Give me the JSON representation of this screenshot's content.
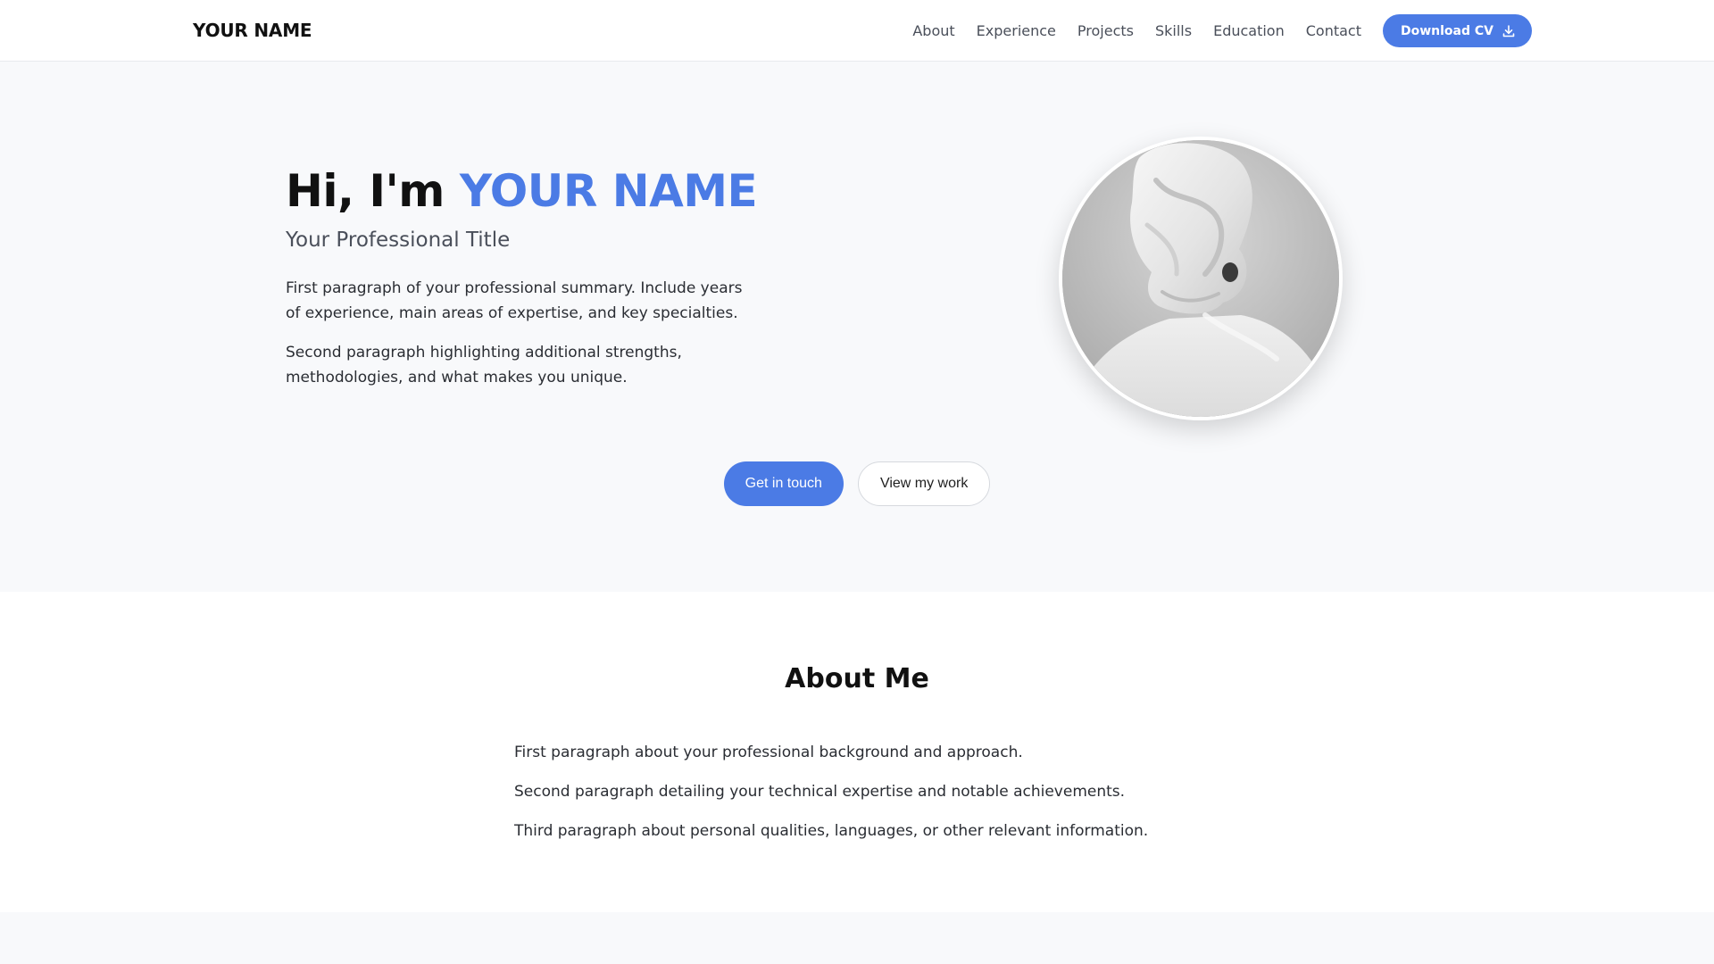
{
  "nav": {
    "brand": "YOUR NAME",
    "links": [
      "About",
      "Experience",
      "Projects",
      "Skills",
      "Education",
      "Contact"
    ],
    "cv_button": "Download CV",
    "cv_icon": "download-icon"
  },
  "hero": {
    "greeting": "Hi, I'm ",
    "name": "YOUR NAME",
    "subtitle": "Your Professional Title",
    "paragraph1": "First paragraph of your professional summary. Include years of experience, main areas of expertise, and key specialties.",
    "paragraph2": "Second paragraph highlighting additional strengths, methodologies, and what makes you unique.",
    "primary_button": "Get in touch",
    "secondary_button": "View my work"
  },
  "about": {
    "title": "About Me",
    "paragraphs": [
      "First paragraph about your professional background and approach.",
      "Second paragraph detailing your technical expertise and notable achievements.",
      "Third paragraph about personal qualities, languages, or other relevant information."
    ]
  },
  "colors": {
    "accent": "#4b7be5",
    "hero_background": "#f8f9fb",
    "text": "#1f1f1f"
  }
}
